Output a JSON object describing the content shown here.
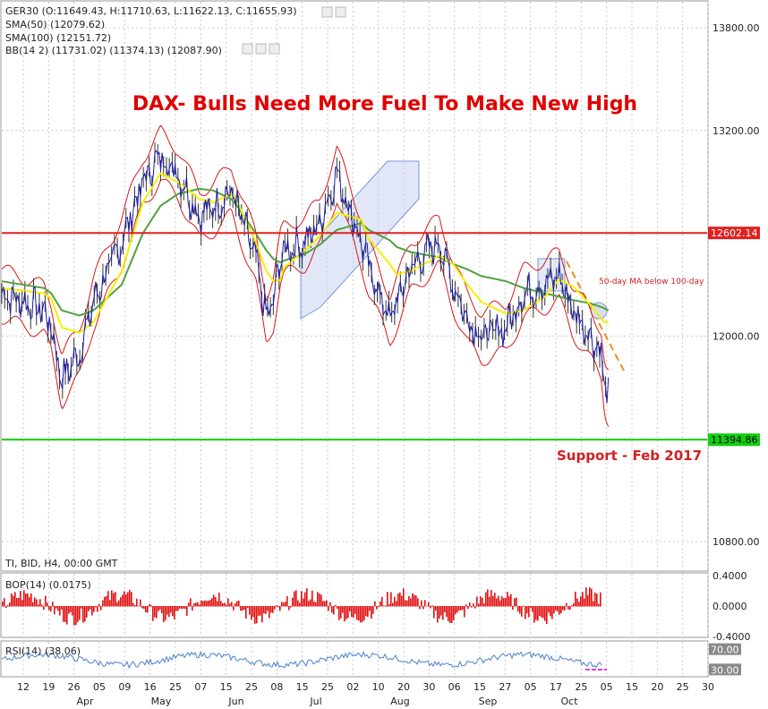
{
  "header": {
    "symbol_line": "GER30 (O:11649.43, H:11710.63, L:11622.13, C:11655.93)",
    "sma50": "SMA(50) (12079.62)",
    "sma100": "SMA(100) (12151.72)",
    "bb": "BB(14 2) (11731.02) (11374.13) (12087.90)",
    "timeframe": "TI, BID, H4, 00:00 GMT"
  },
  "title": "DAX- Bulls Need More Fuel To Make New High",
  "colors": {
    "price": "#1a1aa8",
    "bands": "#d81818",
    "sma50": "#f5f000",
    "sma100": "#52a040",
    "resistance": "#e02020",
    "support": "#10d010",
    "title": "#e00000",
    "grid": "#c8c8c8",
    "channel": "#7896dc",
    "forecast": "#f08c1e",
    "bop": "#e01010",
    "rsi": "#4a7fd0",
    "magenta": "#e040e0"
  },
  "annotations": {
    "ma_note": "50-day MA below 100-day",
    "support_note": "Support - Feb 2017"
  },
  "chart_data": [
    {
      "type": "line",
      "name": "main-price",
      "ylim": [
        10800,
        13950
      ],
      "y_ticks": [
        {
          "value": 13800,
          "label": "13800.00"
        },
        {
          "value": 13200,
          "label": "13200.00"
        },
        {
          "value": 12000,
          "label": "12000.00"
        },
        {
          "value": 10800,
          "label": "10800.00"
        }
      ],
      "levels": [
        {
          "value": 12602.14,
          "label": "12602.14"
        },
        {
          "value": 11394.86,
          "label": "11394.86"
        }
      ],
      "series": [
        {
          "x": [
            0,
            0.06,
            0.07,
            0.085,
            0.11,
            0.13,
            0.17,
            0.2,
            0.225,
            0.25,
            0.28,
            0.3,
            0.325,
            0.33,
            0.36,
            0.375,
            0.385,
            0.395,
            0.4,
            0.43,
            0.45,
            0.475,
            0.51,
            0.52,
            0.55,
            0.56,
            0.58,
            0.62,
            0.64,
            0.66,
            0.68,
            0.715,
            0.74,
            0.77,
            0.79,
            0.81,
            0.835,
            0.85,
            0.855,
            0.86
          ],
          "values": [
            12250,
            12150,
            12050,
            11750,
            11900,
            12200,
            12550,
            12900,
            13050,
            12950,
            12700,
            12750,
            12850,
            12800,
            12450,
            12100,
            12200,
            12450,
            12500,
            12550,
            12650,
            12950,
            12550,
            12400,
            12100,
            12200,
            12400,
            12550,
            12300,
            12100,
            12000,
            12050,
            12250,
            12300,
            12350,
            12150,
            12000,
            11900,
            11700,
            11650
          ]
        },
        {
          "name": "SMA(50)",
          "x": [
            0,
            0.06,
            0.07,
            0.085,
            0.11,
            0.13,
            0.17,
            0.2,
            0.225,
            0.25,
            0.28,
            0.3,
            0.325,
            0.33,
            0.36,
            0.375,
            0.385,
            0.395,
            0.4,
            0.43,
            0.45,
            0.475,
            0.51,
            0.52,
            0.55,
            0.56,
            0.58,
            0.62,
            0.64,
            0.66,
            0.68,
            0.715,
            0.74,
            0.77,
            0.79,
            0.81,
            0.835,
            0.85,
            0.855,
            0.86
          ],
          "values": [
            12280,
            12250,
            12220,
            12050,
            12020,
            12080,
            12380,
            12780,
            12950,
            12900,
            12800,
            12780,
            12830,
            12820,
            12550,
            12380,
            12320,
            12330,
            12400,
            12500,
            12580,
            12720,
            12680,
            12570,
            12420,
            12360,
            12380,
            12470,
            12420,
            12300,
            12200,
            12130,
            12150,
            12230,
            12330,
            12290,
            12180,
            12100,
            12080,
            12080
          ]
        },
        {
          "name": "SMA(100)",
          "x": [
            0,
            0.06,
            0.07,
            0.085,
            0.11,
            0.13,
            0.17,
            0.2,
            0.225,
            0.25,
            0.28,
            0.3,
            0.325,
            0.33,
            0.36,
            0.375,
            0.385,
            0.395,
            0.4,
            0.43,
            0.45,
            0.475,
            0.51,
            0.52,
            0.55,
            0.56,
            0.58,
            0.62,
            0.64,
            0.66,
            0.68,
            0.715,
            0.74,
            0.77,
            0.79,
            0.81,
            0.835,
            0.85,
            0.855,
            0.86
          ],
          "values": [
            12320,
            12280,
            12250,
            12150,
            12120,
            12150,
            12300,
            12600,
            12760,
            12830,
            12860,
            12850,
            12800,
            12780,
            12600,
            12500,
            12450,
            12430,
            12440,
            12480,
            12530,
            12620,
            12660,
            12620,
            12560,
            12520,
            12490,
            12460,
            12420,
            12390,
            12350,
            12320,
            12280,
            12250,
            12230,
            12210,
            12190,
            12170,
            12160,
            12150
          ]
        }
      ]
    },
    {
      "type": "bar",
      "name": "BOP(14)",
      "label": "BOP(14) (0.0175)",
      "ylim": [
        -0.4,
        0.4
      ],
      "y_ticks": [
        {
          "value": 0.4,
          "label": "0.4000"
        },
        {
          "value": 0,
          "label": "0.0000"
        },
        {
          "value": -0.4,
          "label": "-0.4000"
        }
      ]
    },
    {
      "type": "line",
      "name": "RSI(14)",
      "label": "RSI(14) (38.06)",
      "ylim": [
        20,
        80
      ],
      "y_ticks": [
        {
          "value": 70,
          "label": "70.00"
        },
        {
          "value": 30,
          "label": "30.00"
        }
      ]
    }
  ],
  "x_axis": {
    "dates": [
      "12",
      "19",
      "26",
      "05",
      "09",
      "16",
      "25",
      "07",
      "15",
      "25",
      "08",
      "15",
      "25",
      "02",
      "10",
      "20",
      "30",
      "06",
      "15",
      "27",
      "05",
      "17",
      "25",
      "05",
      "15",
      "20",
      "25",
      "30"
    ],
    "months": [
      "Apr",
      "May",
      "Jun",
      "Jul",
      "Aug",
      "Sep",
      "Oct"
    ]
  }
}
